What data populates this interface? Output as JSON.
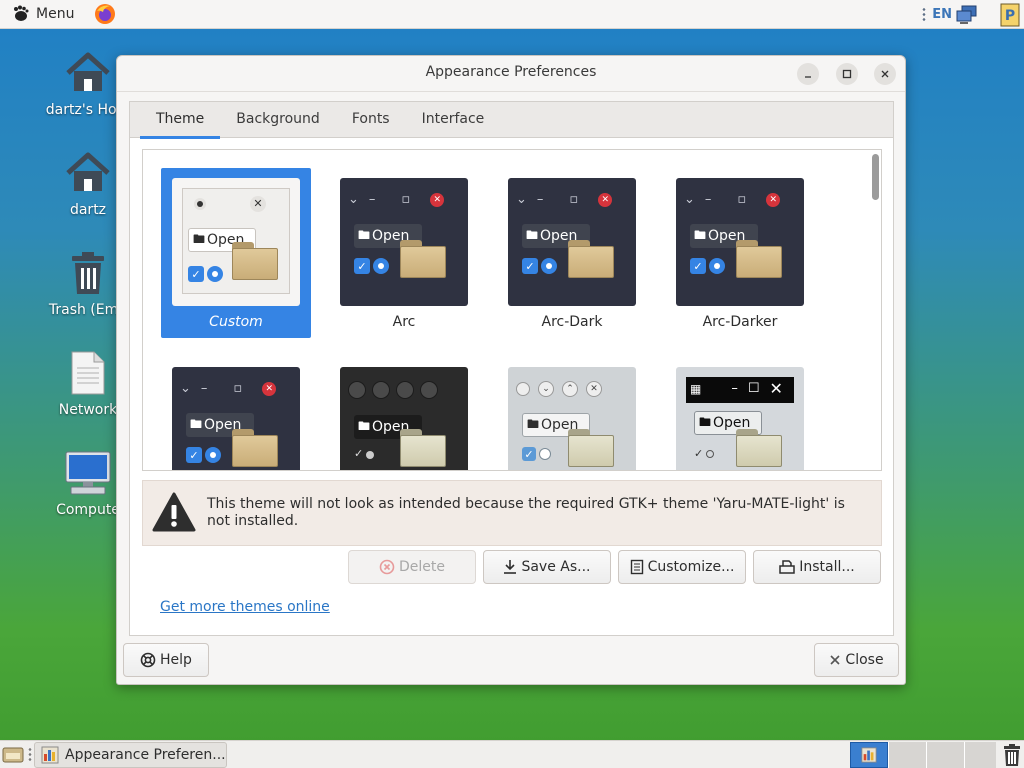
{
  "top_panel": {
    "menu_label": "Menu",
    "language": "EN"
  },
  "desktop_icons": [
    {
      "label": "dartz's Hom",
      "icon": "home-folder-icon"
    },
    {
      "label": "dartz",
      "icon": "home-folder-icon"
    },
    {
      "label": "Trash (Emp",
      "icon": "trash-icon"
    },
    {
      "label": "Network",
      "icon": "network-document-icon"
    },
    {
      "label": "Compute",
      "icon": "computer-icon"
    }
  ],
  "dialog": {
    "title": "Appearance Preferences",
    "tabs": [
      "Theme",
      "Background",
      "Fonts",
      "Interface"
    ],
    "active_tab": "Theme",
    "themes": [
      {
        "name": "Custom",
        "selected": true,
        "style": "light"
      },
      {
        "name": "Arc",
        "selected": false,
        "style": "dark"
      },
      {
        "name": "Arc-Dark",
        "selected": false,
        "style": "dark"
      },
      {
        "name": "Arc-Darker",
        "selected": false,
        "style": "dark"
      },
      {
        "name": "",
        "selected": false,
        "style": "dark"
      },
      {
        "name": "",
        "selected": false,
        "style": "black"
      },
      {
        "name": "",
        "selected": false,
        "style": "grey"
      },
      {
        "name": "",
        "selected": false,
        "style": "classic"
      }
    ],
    "thumb_open_label": "Open",
    "warning": "This theme will not look as intended because the required GTK+ theme 'Yaru-MATE-light' is not installed.",
    "buttons": {
      "delete": "Delete",
      "save_as": "Save As...",
      "customize": "Customize...",
      "install": "Install..."
    },
    "more_themes_link": "Get more themes online",
    "help_label": "Help",
    "close_label": "Close"
  },
  "taskbar": {
    "task_label": "Appearance Preferen..."
  },
  "colors": {
    "accent": "#3584e4",
    "link": "#2a76c6",
    "dark_theme_bg": "#2f3241"
  }
}
